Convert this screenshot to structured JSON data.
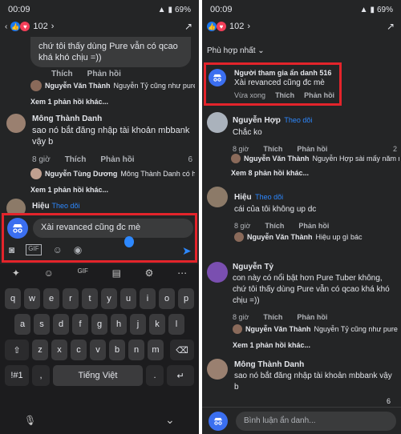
{
  "status": {
    "time": "00:09",
    "battery": "69%"
  },
  "reactions": {
    "count": "102"
  },
  "left": {
    "top_comment_tail": "chứ tôi thấy dùng Pure vẫn có qcao khá khó chịu =))",
    "top_actions": {
      "like": "Thích",
      "reply": "Phản hồi"
    },
    "reply1": {
      "name": "Nguyễn Văn Thành",
      "text": "Nguyễn Tỷ cũng như pure nên khỏi...",
      "more": "Xem 1 phản hồi khác..."
    },
    "comment2": {
      "name": "Mông Thành Danh",
      "text": "sao nó bắt đăng nhập tài khoản mbbank vậy b",
      "time": "8 giờ",
      "like": "Thích",
      "reply": "Phản hồi",
      "count": "6"
    },
    "reply2": {
      "name": "Nguyễn Tùng Dương",
      "text": "Mông Thành Danh có hả bn ??",
      "more": "Xem 1 phản hồi khác..."
    },
    "comment3": {
      "name": "Hiệu",
      "follow": "Theo dõi"
    },
    "composer": {
      "text": "Xài revanced cũng đc mè"
    },
    "keyboard": {
      "row1": [
        "q",
        "w",
        "e",
        "r",
        "t",
        "y",
        "u",
        "i",
        "o",
        "p"
      ],
      "row2": [
        "a",
        "s",
        "d",
        "f",
        "g",
        "h",
        "j",
        "k",
        "l"
      ],
      "row3": [
        "z",
        "x",
        "c",
        "v",
        "b",
        "n",
        "m"
      ],
      "sym": "!#1",
      "comma": ",",
      "space": "Tiếng Việt",
      "dot": ".",
      "enter": "↵"
    }
  },
  "right": {
    "sort": "Phù hợp nhất",
    "new_comment": {
      "name": "Người tham gia ẩn danh 516",
      "text": "Xài revanced cũng đc mè",
      "time": "Vừa xong",
      "like": "Thích",
      "reply": "Phản hồi"
    },
    "c1": {
      "name": "Nguyễn Hợp",
      "follow": "Theo dõi",
      "text": "Chắc ko",
      "time": "8 giờ",
      "like": "Thích",
      "reply": "Phản hồi",
      "count": "2"
    },
    "c1_reply": {
      "name": "Nguyễn Văn Thành",
      "text": "Nguyễn Hợp sài mấy năm rồi,...",
      "more": "Xem 8 phản hồi khác..."
    },
    "c2": {
      "name": "Hiệu",
      "follow": "Theo dõi",
      "text": "cái của tôi không up dc",
      "time": "8 giờ",
      "like": "Thích",
      "reply": "Phản hồi"
    },
    "c2_reply": {
      "name": "Nguyễn Văn Thành",
      "text": "Hiệu up gì bác"
    },
    "c3": {
      "name": "Nguyễn Tỷ",
      "text": "con này có nổi bật hơn Pure Tuber không, chứ tôi thấy dùng Pure vẫn có qcao khá khó chịu =))",
      "time": "8 giờ",
      "like": "Thích",
      "reply": "Phản hồi"
    },
    "c3_reply": {
      "name": "Nguyễn Văn Thành",
      "text": "Nguyễn Tỷ cũng như pure nên...",
      "more": "Xem 1 phản hồi khác..."
    },
    "c4": {
      "name": "Mông Thành Danh",
      "text": "sao nó bắt đăng nhập tài khoản mbbank vậy b",
      "count": "6"
    },
    "composer_placeholder": "Bình luận ẩn danh..."
  }
}
